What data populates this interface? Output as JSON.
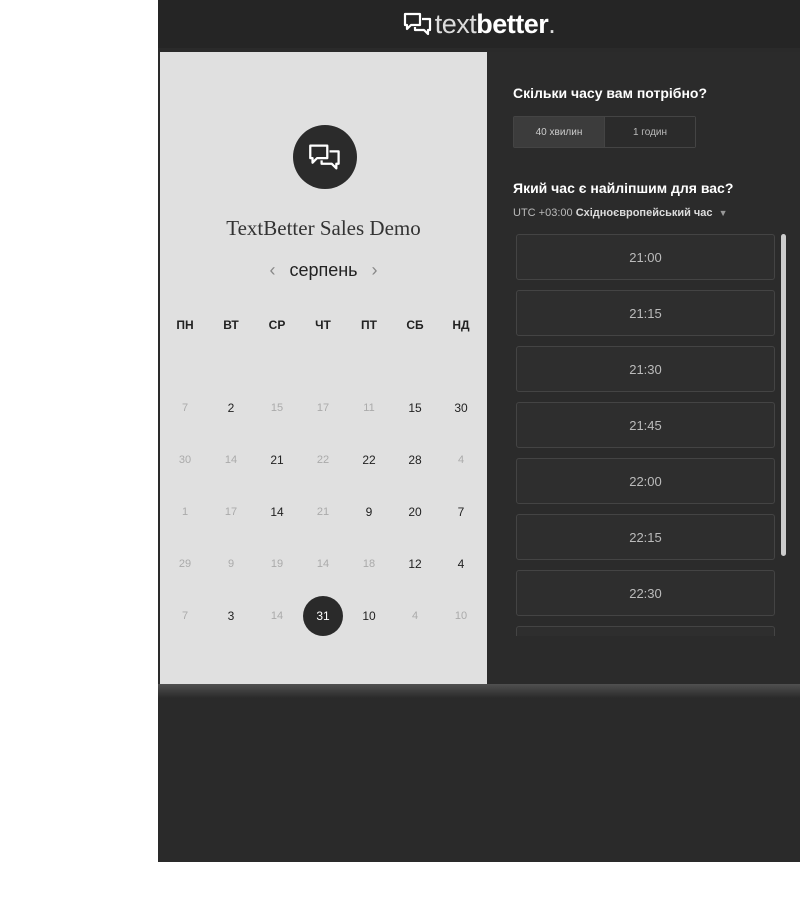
{
  "brand": {
    "logo_light": "text",
    "logo_bold": "better",
    "logo_dot": "."
  },
  "event": {
    "title": "TextBetter Sales Demo"
  },
  "calendar": {
    "month": "серпень",
    "prev_icon": "chevron-left-icon",
    "next_icon": "chevron-right-icon",
    "weekdays": [
      "ПН",
      "ВТ",
      "СР",
      "ЧТ",
      "ПТ",
      "СБ",
      "НД"
    ],
    "rows": [
      [
        {
          "d": "7",
          "dim": true
        },
        {
          "d": "2",
          "dim": false
        },
        {
          "d": "15",
          "dim": true
        },
        {
          "d": "17",
          "dim": true
        },
        {
          "d": "11",
          "dim": true
        },
        {
          "d": "15",
          "dim": false
        },
        {
          "d": "30",
          "dim": false
        }
      ],
      [
        {
          "d": "30",
          "dim": true
        },
        {
          "d": "14",
          "dim": true
        },
        {
          "d": "21",
          "dim": false
        },
        {
          "d": "22",
          "dim": true
        },
        {
          "d": "22",
          "dim": false
        },
        {
          "d": "28",
          "dim": false
        },
        {
          "d": "4",
          "dim": true
        }
      ],
      [
        {
          "d": "1",
          "dim": true
        },
        {
          "d": "17",
          "dim": true
        },
        {
          "d": "14",
          "dim": false
        },
        {
          "d": "21",
          "dim": true
        },
        {
          "d": "9",
          "dim": false
        },
        {
          "d": "20",
          "dim": false
        },
        {
          "d": "7",
          "dim": false
        }
      ],
      [
        {
          "d": "29",
          "dim": true
        },
        {
          "d": "9",
          "dim": true
        },
        {
          "d": "19",
          "dim": true
        },
        {
          "d": "14",
          "dim": true
        },
        {
          "d": "18",
          "dim": true
        },
        {
          "d": "12",
          "dim": false
        },
        {
          "d": "4",
          "dim": false
        }
      ],
      [
        {
          "d": "7",
          "dim": true
        },
        {
          "d": "3",
          "dim": false
        },
        {
          "d": "14",
          "dim": true
        },
        {
          "d": "31",
          "dim": false,
          "selected": true
        },
        {
          "d": "10",
          "dim": false
        },
        {
          "d": "4",
          "dim": true
        },
        {
          "d": "10",
          "dim": true
        }
      ]
    ]
  },
  "duration": {
    "question": "Скільки часу вам потрібно?",
    "options": [
      "40 хвилин",
      "1 годин"
    ],
    "selected": 0
  },
  "time": {
    "question": "Який час є найліпшим для вас?",
    "tz_offset": "UTC +03:00",
    "tz_name": "Східноєвропейський час",
    "slots": [
      "21:00",
      "21:15",
      "21:30",
      "21:45",
      "22:00",
      "22:15",
      "22:30",
      ""
    ]
  }
}
